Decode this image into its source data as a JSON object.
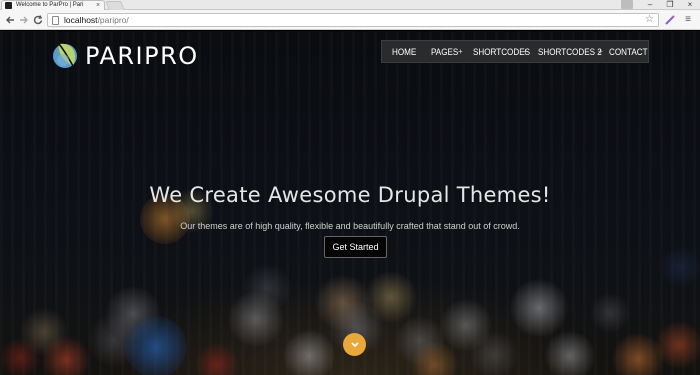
{
  "browser": {
    "tab_title": "Welcome to ParPro | Pari",
    "tab_close": "×",
    "url_host": "localhost",
    "url_path": "/paripro/",
    "window_controls": [
      "–",
      "❐",
      "×"
    ],
    "icons": [
      "back-icon",
      "forward-icon",
      "reload-icon",
      "page-icon",
      "star-icon",
      "pen-extension-icon",
      "menu-icon"
    ]
  },
  "site": {
    "logo_text": "PARIPRO",
    "nav": {
      "items": [
        "HOME",
        "PAGES",
        "SHORTCODES",
        "SHORTCODES 2",
        "CONTACT"
      ],
      "expand_symbol": "+"
    },
    "hero": {
      "title": "We Create Awesome Drupal Themes!",
      "subtitle": "Our themes are of high quality, flexible and beautifully crafted that stand out of crowd.",
      "button_label": "Get Started"
    }
  },
  "colors": {
    "accent": "#e8a93a",
    "nav_background": "#2a2b2d",
    "logo_blue": "#5b9bc9",
    "logo_green": "#b9d36b"
  }
}
